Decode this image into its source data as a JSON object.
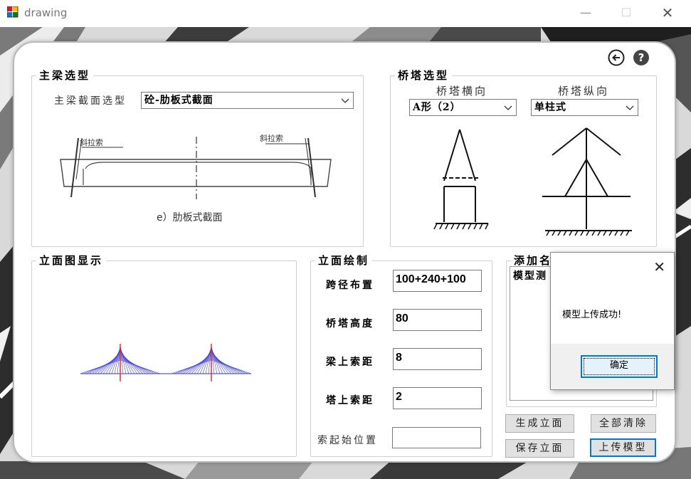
{
  "window": {
    "title": "drawing"
  },
  "girder": {
    "group_title": "主梁选型",
    "section_label": "主梁截面选型",
    "section_value": "砼-肋板式截面",
    "diagram": {
      "cable_left": "斜拉索",
      "cable_right": "斜拉索",
      "caption": "e）肋板式截面"
    }
  },
  "tower": {
    "group_title": "桥塔选型",
    "transverse_label": "桥塔横向",
    "transverse_value": "A形（2）",
    "longitudinal_label": "桥塔纵向",
    "longitudinal_value": "单柱式"
  },
  "elevation_view": {
    "group_title": "立面图显示"
  },
  "elevation_draw": {
    "group_title": "立面绘制",
    "fields": [
      {
        "label": "跨径布置",
        "value": "100+240+100"
      },
      {
        "label": "桥塔高度",
        "value": "80"
      },
      {
        "label": "梁上索距",
        "value": "8"
      },
      {
        "label": "塔上索距",
        "value": "2"
      },
      {
        "label": "索起始位置",
        "value": ""
      }
    ]
  },
  "add_model": {
    "group_title": "添加名",
    "list_item": "模型测"
  },
  "buttons": {
    "generate": "生成立面",
    "clear_all": "全部清除",
    "save": "保存立面",
    "upload": "上传模型"
  },
  "dialog": {
    "message": "模型上传成功!",
    "ok": "确定"
  },
  "icons": {
    "back": "back-arrow-icon",
    "help": "help-icon"
  }
}
